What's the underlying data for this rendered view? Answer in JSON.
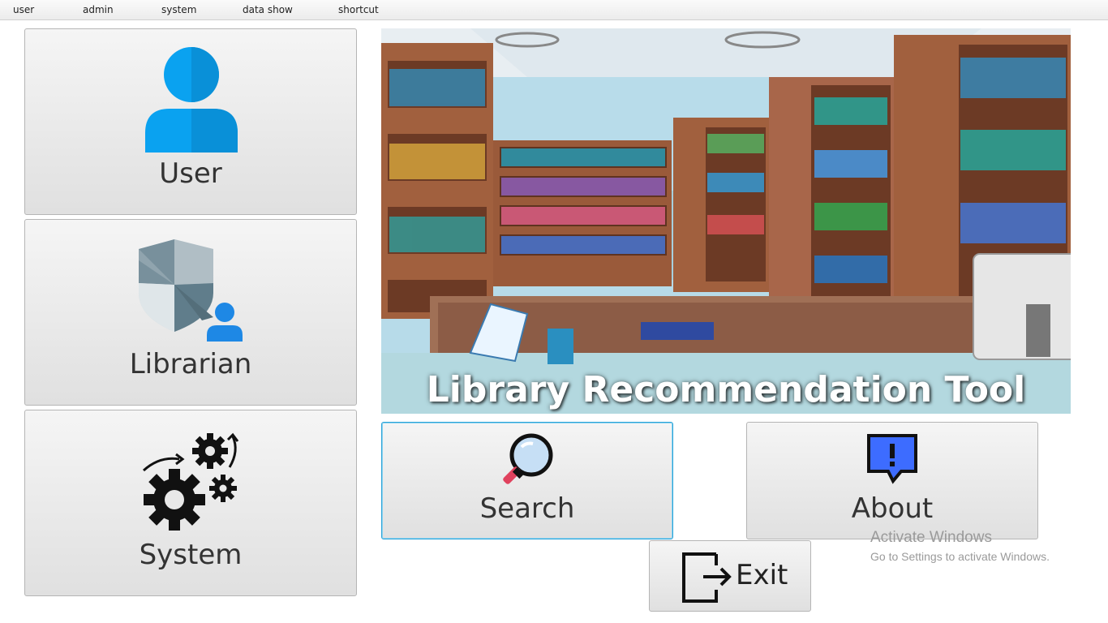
{
  "menu": {
    "items": [
      {
        "label": "user"
      },
      {
        "label": "admin"
      },
      {
        "label": "system"
      },
      {
        "label": "data show"
      },
      {
        "label": "shortcut"
      }
    ]
  },
  "left_buttons": {
    "user": {
      "label": "User",
      "icon": "user-icon"
    },
    "librarian": {
      "label": "Librarian",
      "icon": "librarian-shield-icon"
    },
    "system": {
      "label": "System",
      "icon": "gears-icon"
    }
  },
  "banner": {
    "title": "Library Recommendation Tool",
    "image": "library-illustration"
  },
  "actions": {
    "search": {
      "label": "Search",
      "icon": "magnifier-icon"
    },
    "about": {
      "label": "About",
      "icon": "info-bubble-icon"
    },
    "exit": {
      "label": "Exit",
      "icon": "exit-door-icon"
    }
  },
  "watermark": {
    "line1": "Activate Windows",
    "line2": "Go to Settings to activate Windows."
  },
  "colors": {
    "user_icon": "#0aa2f0",
    "about_icon": "#3d6cff",
    "focus_border": "#2aa3d8"
  }
}
